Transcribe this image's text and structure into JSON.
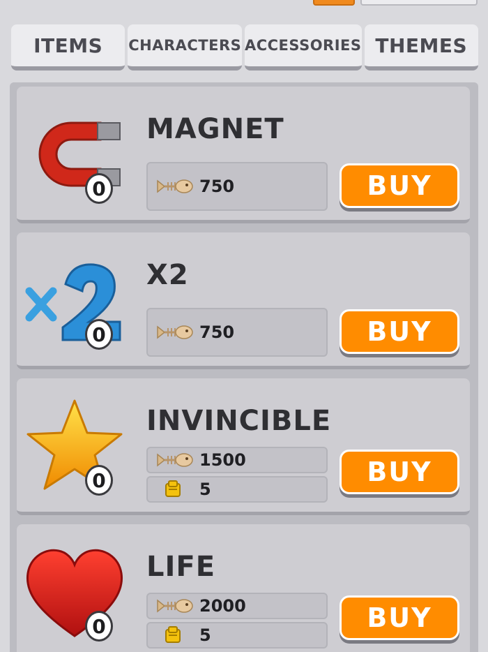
{
  "tabs": [
    {
      "label": "ITEMS"
    },
    {
      "label": "CHARACTERS"
    },
    {
      "label": "ACCESSORIES"
    },
    {
      "label": "THEMES"
    }
  ],
  "items": [
    {
      "title": "MAGNET",
      "icon": "magnet-icon",
      "count": "0",
      "prices": [
        {
          "currency": "fish-coin-icon",
          "value": "750"
        }
      ],
      "buy_label": "BUY"
    },
    {
      "title": "X2",
      "icon": "x2-multiplier-icon",
      "count": "0",
      "prices": [
        {
          "currency": "fish-coin-icon",
          "value": "750"
        }
      ],
      "buy_label": "BUY"
    },
    {
      "title": "INVINCIBLE",
      "icon": "star-icon",
      "count": "0",
      "prices": [
        {
          "currency": "fish-coin-icon",
          "value": "1500"
        },
        {
          "currency": "cheese-token-icon",
          "value": "5"
        }
      ],
      "buy_label": "BUY"
    },
    {
      "title": "LIFE",
      "icon": "heart-icon",
      "count": "0",
      "prices": [
        {
          "currency": "fish-coin-icon",
          "value": "2000"
        },
        {
          "currency": "cheese-token-icon",
          "value": "5"
        }
      ],
      "buy_label": "BUY"
    }
  ],
  "colors": {
    "accent": "#ff8c00",
    "card": "#cecdd2",
    "text": "#2f2f33"
  }
}
